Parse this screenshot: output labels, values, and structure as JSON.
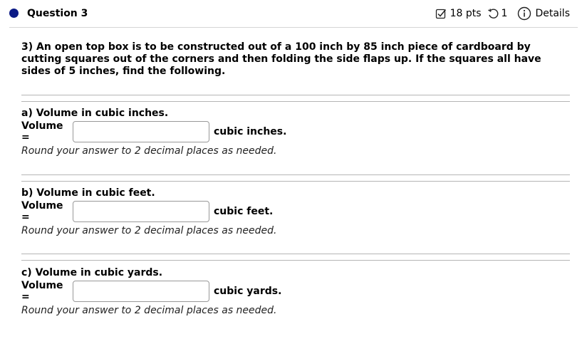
{
  "header": {
    "question_label": "Question 3",
    "points": "18 pts",
    "tries": "1",
    "details": "Details",
    "icons": [
      "checkbox-icon",
      "undo-icon",
      "info-icon"
    ],
    "bullet_color": "#0b1a86"
  },
  "question_text": "3) An open top box is to be constructed out of a 100 inch by 85 inch piece of cardboard by cutting squares out of the corners and then folding the side flaps up. If the squares all have sides of 5 inches, find the following.",
  "parts": [
    {
      "title": "a) Volume in cubic inches.",
      "label": "Volume =",
      "value": "",
      "unit": "cubic inches.",
      "hint": "Round your answer to 2 decimal places as needed."
    },
    {
      "title": "b) Volume in cubic feet.",
      "label": "Volume =",
      "value": "",
      "unit": "cubic feet.",
      "hint": "Round your answer to 2 decimal places as needed."
    },
    {
      "title": "c) Volume in cubic yards.",
      "label": "Volume =",
      "value": "",
      "unit": "cubic yards.",
      "hint": "Round your answer to 2 decimal places as needed."
    }
  ]
}
